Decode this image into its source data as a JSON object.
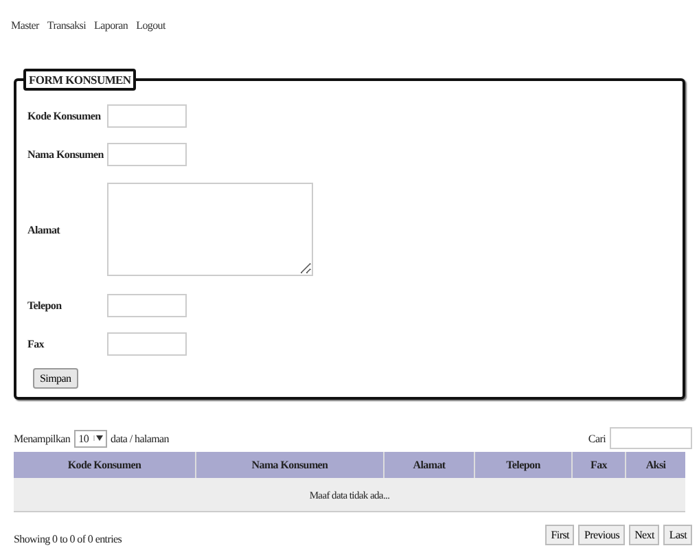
{
  "menu": [
    "Master",
    "Transaksi",
    "Laporan",
    "Logout"
  ],
  "form": {
    "legend": "FORM KONSUMEN",
    "fields": [
      {
        "label": "Kode Konsumen",
        "kind": "input"
      },
      {
        "label": "Nama Konsumen",
        "kind": "input"
      },
      {
        "label": "Alamat",
        "kind": "textarea"
      },
      {
        "label": "Telepon",
        "kind": "input"
      },
      {
        "label": "Fax",
        "kind": "input"
      }
    ],
    "submit": "Simpan"
  },
  "table": {
    "length_label_before": "Menampilkan",
    "length_value": "10",
    "length_label_after": "data / halaman",
    "search_label": "Cari",
    "columns": [
      "Kode Konsumen",
      "Nama Konsumen",
      "Alamat",
      "Telepon",
      "Fax",
      "Aksi"
    ],
    "empty": "Maaf data tidak ada...",
    "info": "Showing 0 to 0 of 0 entries",
    "pagination": [
      "First",
      "Previous",
      "Next",
      "Last"
    ]
  }
}
